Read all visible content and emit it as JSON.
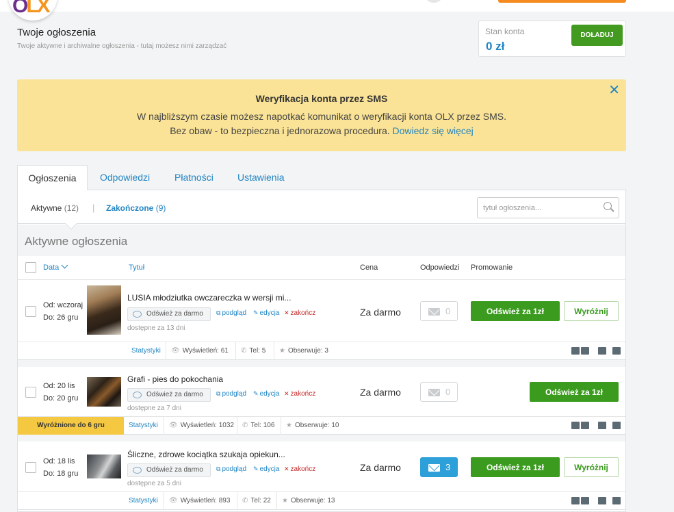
{
  "logo": {
    "text_left": "O",
    "text_right": "LX"
  },
  "header": {
    "title": "Twoje ogłoszenia",
    "subtitle": "Twoje aktywne i archiwalne ogłoszenia - tutaj możesz nimi zarządzać"
  },
  "balance": {
    "label": "Stan konta",
    "value": "0 zł",
    "topup_label": "DOŁADUJ"
  },
  "banner": {
    "title": "Weryfikacja konta przez SMS",
    "line1": "W najbliższym czasie możesz napotkać komunikat o weryfikacji konta OLX przez SMS.",
    "line2": "Bez obaw - to bezpieczna i jednorazowa procedura.",
    "link": "Dowiedz się więcej",
    "close": "✕"
  },
  "tabs": [
    "Ogłoszenia",
    "Odpowiedzi",
    "Płatności",
    "Ustawienia"
  ],
  "filters": {
    "active_label": "Aktywne",
    "active_count": "(12)",
    "separator": "|",
    "ended_label": "Zakończone",
    "ended_count": "(9)",
    "search_placeholder": "tytuł ogłoszenia..."
  },
  "section_title": "Aktywne ogłoszenia",
  "columns": {
    "date": "Data",
    "title": "Tytuł",
    "price": "Cena",
    "responses": "Odpowiedzi",
    "promotion": "Promowanie"
  },
  "labels": {
    "refresh_free": "Odśwież za darmo",
    "preview": "podgląd",
    "edit": "edycja",
    "end": "zakończ",
    "refresh_paid": "Odśwież za 1zł",
    "feature": "Wyróżnij",
    "stats": "Statystyki"
  },
  "ads": [
    {
      "date_from": "Od: wczoraj",
      "date_to": "Do: 26 gru",
      "title": "LUSIA młodziutka owczareczka w wersji mi...",
      "available": "dostępne za 13 dni",
      "price": "Za darmo",
      "responses": "0",
      "views": "Wyświetleń: 61",
      "phone": "Tel: 5",
      "watch": "Obserwuje: 3",
      "featured": ""
    },
    {
      "date_from": "Od: 20 lis",
      "date_to": "Do: 20 gru",
      "title": "Grafi - pies do pokochania",
      "available": "dostępne za 7 dni",
      "price": "Za darmo",
      "responses": "0",
      "views": "Wyświetleń: 1032",
      "phone": "Tel: 106",
      "watch": "Obserwuje: 10",
      "featured": "Wyróżnione do 6 gru"
    },
    {
      "date_from": "Od: 18 lis",
      "date_to": "Do: 18 gru",
      "title": "Śliczne, zdrowe kociątka szukaja opiekun...",
      "available": "dostępne za 5 dni",
      "price": "Za darmo",
      "responses": "3",
      "views": "Wyświetleń: 893",
      "phone": "Tel: 22",
      "watch": "Obserwuje: 13",
      "featured": ""
    }
  ],
  "colors": {
    "accent": "#2285c2",
    "green": "#3b9b1f",
    "banner": "#fae396",
    "featured": "#f5c842"
  }
}
